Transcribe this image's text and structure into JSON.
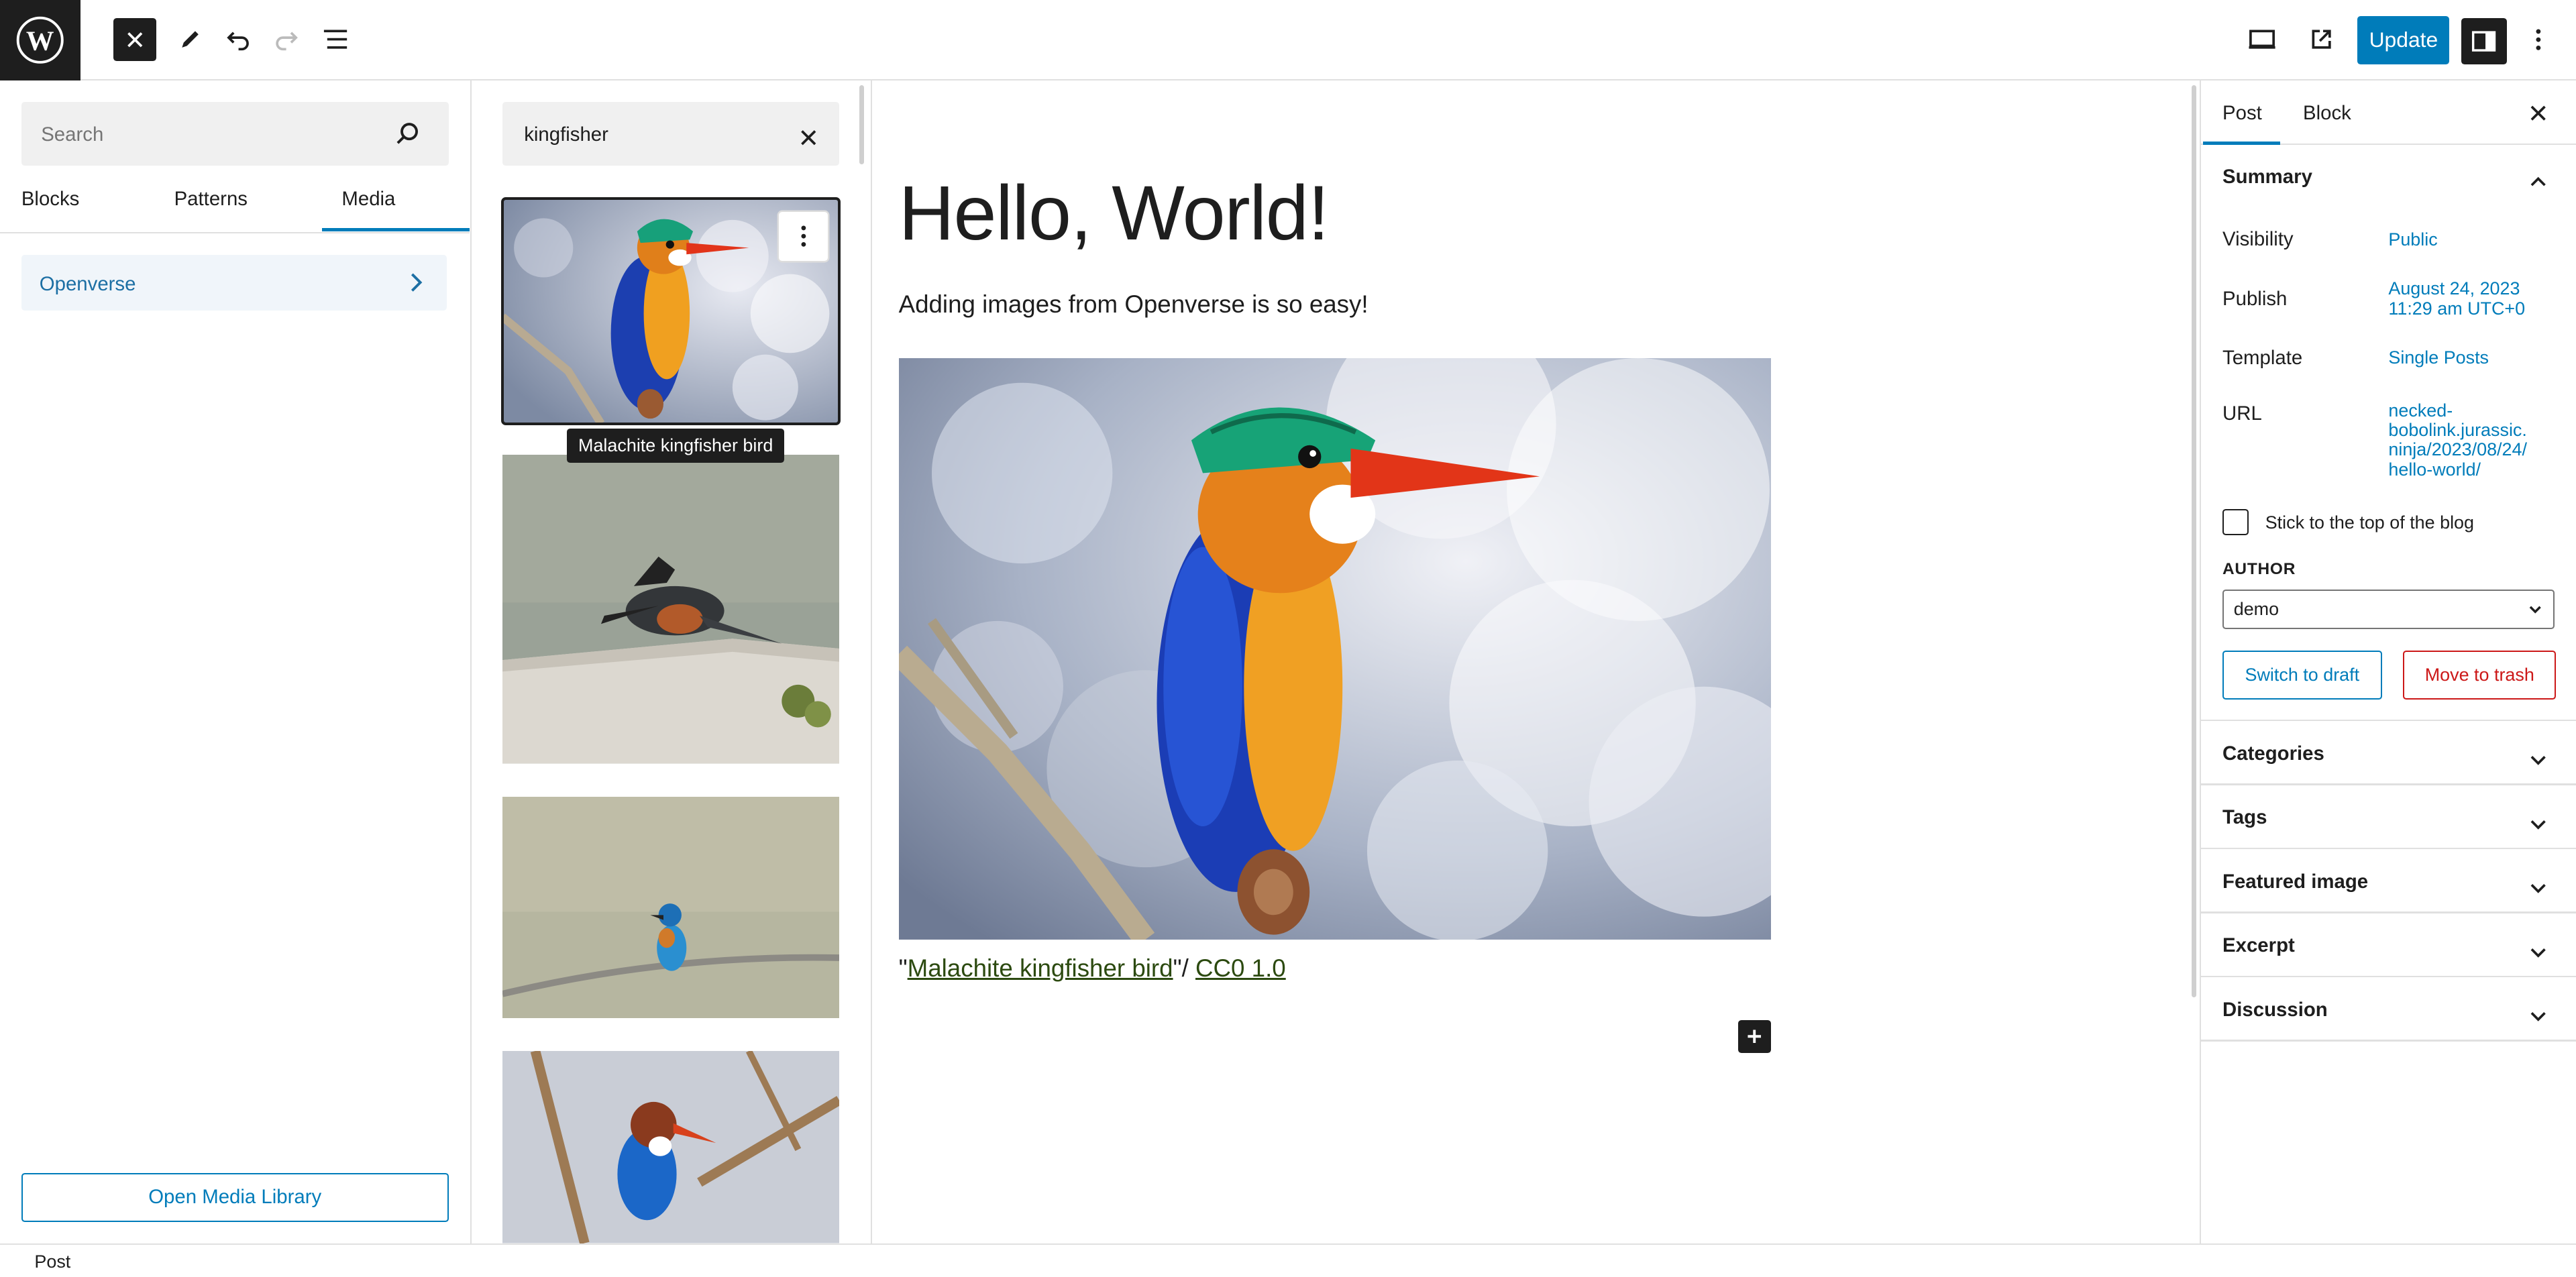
{
  "topbar": {
    "update_label": "Update",
    "icons": [
      "wordpress-logo-icon",
      "close-icon",
      "pencil-icon",
      "undo-icon",
      "redo-icon",
      "list-view-icon",
      "desktop-icon",
      "external-link-icon",
      "sidebar-icon",
      "more-vertical-icon"
    ]
  },
  "inserter": {
    "search_placeholder": "Search",
    "tabs": [
      {
        "label": "Blocks"
      },
      {
        "label": "Patterns"
      },
      {
        "label": "Media"
      }
    ],
    "active_tab": "Media",
    "category": "Openverse",
    "open_media_library": "Open Media Library"
  },
  "media": {
    "search_value": "kingfisher",
    "tooltip": "Malachite kingfisher bird"
  },
  "post": {
    "title": "Hello, World!",
    "paragraph": "Adding images from Openverse is so easy!",
    "caption": {
      "prefix": "\"",
      "link_title": "Malachite kingfisher bird",
      "middle": "\"/ ",
      "license": "CC0 1.0"
    }
  },
  "sidebar": {
    "tabs": [
      {
        "label": "Post"
      },
      {
        "label": "Block"
      }
    ],
    "summary_title": "Summary",
    "visibility": {
      "label": "Visibility",
      "value": "Public"
    },
    "publish": {
      "label": "Publish",
      "value_line1": "August 24, 2023",
      "value_line2": "11:29 am UTC+0"
    },
    "template": {
      "label": "Template",
      "value": "Single Posts"
    },
    "url": {
      "label": "URL",
      "lines": [
        "necked-",
        "bobolink.jurassic.",
        "ninja/2023/08/24/",
        "hello-world/"
      ]
    },
    "sticky_label": "Stick to the top of the blog",
    "author_label": "AUTHOR",
    "author_value": "demo",
    "switch_draft": "Switch to draft",
    "move_trash": "Move to trash",
    "sections": [
      {
        "label": "Categories"
      },
      {
        "label": "Tags"
      },
      {
        "label": "Featured image"
      },
      {
        "label": "Excerpt"
      },
      {
        "label": "Discussion"
      }
    ]
  },
  "footer": {
    "breadcrumb": "Post"
  },
  "colors": {
    "accent": "#007cba",
    "danger": "#cc1818",
    "dark": "#1e1e1e"
  }
}
